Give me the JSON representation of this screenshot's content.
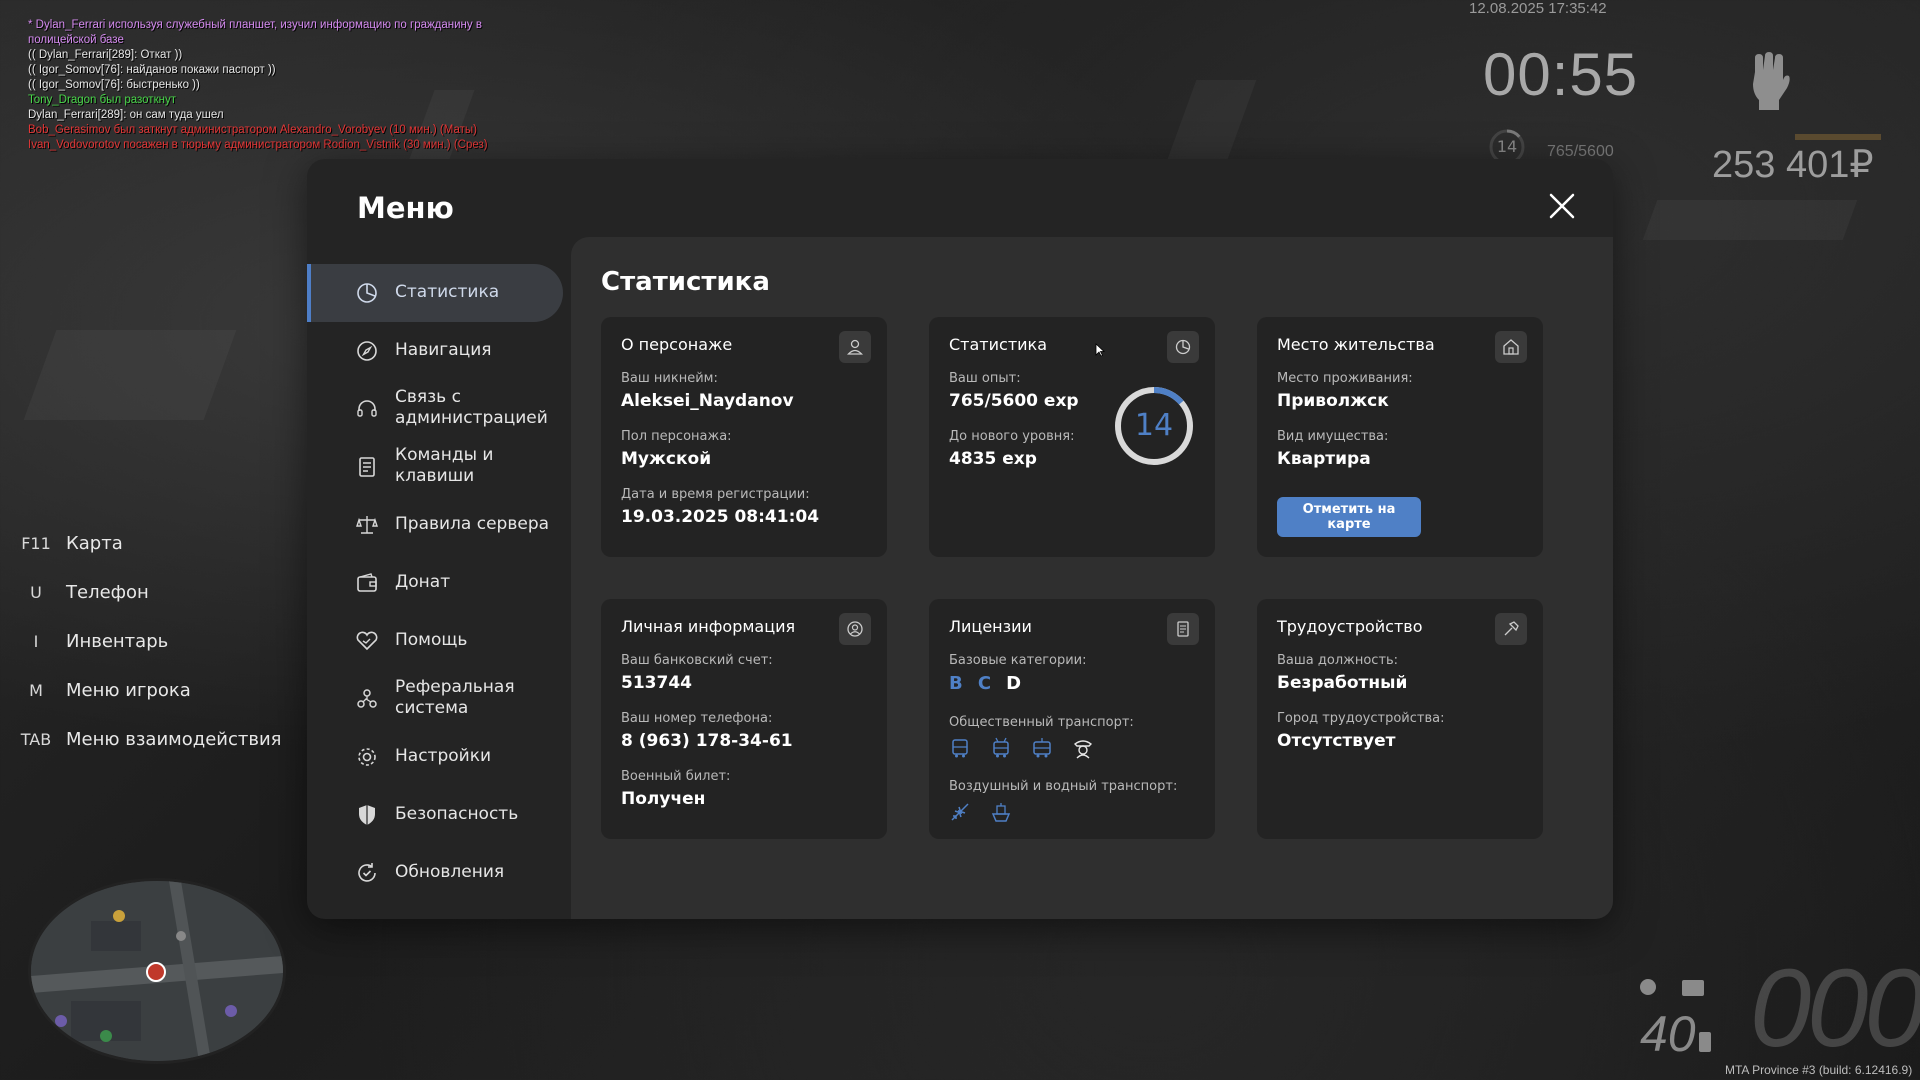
{
  "chat": [
    {
      "text": "* Dylan_Ferrari используя служебный планшет, изучил информацию по гражданину в полицейской базе",
      "color": "#d58bf0"
    },
    {
      "text": "(( Dylan_Ferrari[289]: Откат ))",
      "color": "#e6e6e6"
    },
    {
      "text": "(( Igor_Somov[76]: найданов покажи паспорт ))",
      "color": "#e6e6e6"
    },
    {
      "text": "(( Igor_Somov[76]: быстренько ))",
      "color": "#e6e6e6"
    },
    {
      "text": "Tony_Dragon был разоткнут",
      "color": "#49d64a"
    },
    {
      "text": "Dylan_Ferrari[289]: он сам туда ушел",
      "color": "#e6e6e6",
      "prefix": "Dylan_Ferrari[289]:",
      "prefix_color": "#49d64a"
    },
    {
      "text": "Bob_Gerasimov был заткнут администратором Alexandro_Vorobyev (10 мин.) (Маты)",
      "color": "#e23636"
    },
    {
      "text": "Ivan_Vodovorotov посажен в тюрьму администратором Rodion_Vistnik (30 мин.) (Срез)",
      "color": "#e23636"
    }
  ],
  "hud": {
    "datetime": "12.08.2025 17:35:42",
    "clock": "00:55",
    "level": "14",
    "exp": "765/5600",
    "money": "253 401₽"
  },
  "keybinds": [
    {
      "key": "F11",
      "label": "Карта"
    },
    {
      "key": "U",
      "label": "Телефон"
    },
    {
      "key": "I",
      "label": "Инвентарь"
    },
    {
      "key": "M",
      "label": "Меню игрока"
    },
    {
      "key": "TAB",
      "label": "Меню взаимодействия"
    }
  ],
  "vehicle": {
    "speed": "000",
    "fuel": "40"
  },
  "build": "MTA Province #3 (build: 6.12416.9)",
  "menu": {
    "title": "Меню",
    "nav": [
      {
        "id": "stats",
        "label": "Статистика",
        "icon": "pie-chart-icon"
      },
      {
        "id": "navigation",
        "label": "Навигация",
        "icon": "compass-icon"
      },
      {
        "id": "admin-contact",
        "label": "Связь с администрацией",
        "icon": "headset-icon"
      },
      {
        "id": "commands",
        "label": "Команды и клавиши",
        "icon": "document-icon"
      },
      {
        "id": "rules",
        "label": "Правила сервера",
        "icon": "scales-icon"
      },
      {
        "id": "donate",
        "label": "Донат",
        "icon": "wallet-icon"
      },
      {
        "id": "help",
        "label": "Помощь",
        "icon": "handshake-icon"
      },
      {
        "id": "referral",
        "label": "Реферальная система",
        "icon": "people-icon"
      },
      {
        "id": "settings",
        "label": "Настройки",
        "icon": "gear-icon"
      },
      {
        "id": "security",
        "label": "Безопасность",
        "icon": "shield-icon"
      },
      {
        "id": "updates",
        "label": "Обновления",
        "icon": "refresh-icon"
      }
    ]
  },
  "content": {
    "title": "Статистика",
    "character": {
      "title": "О персонаже",
      "nickname_label": "Ваш никнейм:",
      "nickname": "Aleksei_Naydanov",
      "gender_label": "Пол персонажа:",
      "gender": "Мужской",
      "reg_label": "Дата и время регистрации:",
      "reg": "19.03.2025 08:41:04"
    },
    "stats": {
      "title": "Статистика",
      "exp_label": "Ваш опыт:",
      "exp": "765/5600 exp",
      "next_label": "До нового уровня:",
      "next": "4835 exp",
      "level": "14",
      "level_progress": 0.137
    },
    "residence": {
      "title": "Место жительства",
      "place_label": "Место проживания:",
      "place": "Приволжск",
      "type_label": "Вид имущества:",
      "type": "Квартира",
      "button": "Отметить на карте"
    },
    "personal": {
      "title": "Личная информация",
      "bank_label": "Ваш банковский счет:",
      "bank": "513744",
      "phone_label": "Ваш номер телефона:",
      "phone": "8 (963) 178-34-61",
      "military_label": "Военный билет:",
      "military": "Получен"
    },
    "licenses": {
      "title": "Лицензии",
      "base_label": "Базовые категории:",
      "categories": [
        {
          "name": "B",
          "color": "#4f80c6"
        },
        {
          "name": "C",
          "color": "#4f80c6"
        },
        {
          "name": "D",
          "color": "#ffffff"
        }
      ],
      "public_label": "Общественный транспорт:",
      "air_label": "Воздушный и водный транспорт:"
    },
    "employment": {
      "title": "Трудоустройство",
      "position_label": "Ваша должность:",
      "position": "Безработный",
      "city_label": "Город трудоустройства:",
      "city": "Отсутствует"
    }
  }
}
